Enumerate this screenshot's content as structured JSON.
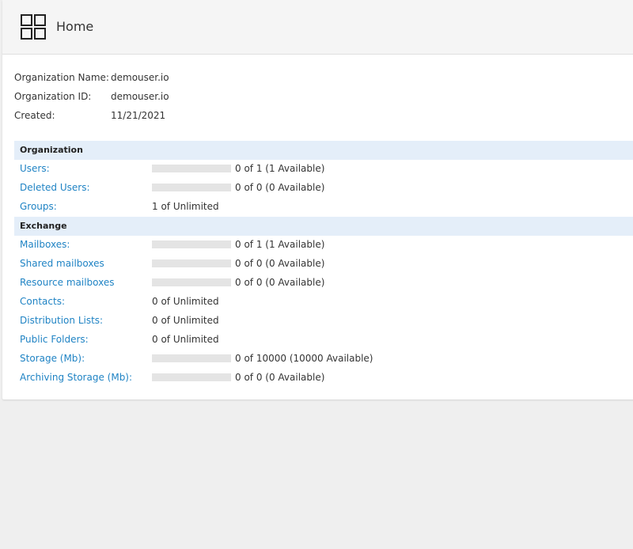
{
  "header": {
    "title": "Home",
    "icon": "dashboard-grid-icon"
  },
  "org_info": [
    {
      "label": "Organization Name:",
      "value": "demouser.io"
    },
    {
      "label": "Organization ID:",
      "value": "demouser.io"
    },
    {
      "label": "Created:",
      "value": "11/21/2021"
    }
  ],
  "sections": {
    "organization": {
      "title": "Organization",
      "rows": [
        {
          "label": "Users:",
          "value": "0 of 1 (1 Available)",
          "usage": 0
        },
        {
          "label": "Deleted Users:",
          "value": "0 of 0 (0 Available)",
          "usage": 0
        },
        {
          "label": "Groups:",
          "value": "1 of Unlimited"
        }
      ]
    },
    "exchange": {
      "title": "Exchange",
      "rows": [
        {
          "label": "Mailboxes:",
          "value": "0 of 1 (1 Available)",
          "usage": 0
        },
        {
          "label": "Shared mailboxes",
          "value": "0 of 0 (0 Available)",
          "usage": 0
        },
        {
          "label": "Resource mailboxes",
          "value": "0 of 0 (0 Available)",
          "usage": 0
        },
        {
          "label": "Contacts:",
          "value": "0 of Unlimited"
        },
        {
          "label": "Distribution Lists:",
          "value": "0 of Unlimited"
        },
        {
          "label": "Public Folders:",
          "value": "0 of Unlimited"
        },
        {
          "label": "Storage (Mb):",
          "value": "0 of 10000 (10000 Available)",
          "usage": 0
        },
        {
          "label": "Archiving Storage (Mb):",
          "value": "0 of 0 (0 Available)",
          "usage": 0
        }
      ]
    }
  },
  "colors": {
    "link": "#1f83c4",
    "section_bg": "#e4eef9",
    "bar_bg": "#e4e4e4",
    "page_bg": "#efefef"
  }
}
